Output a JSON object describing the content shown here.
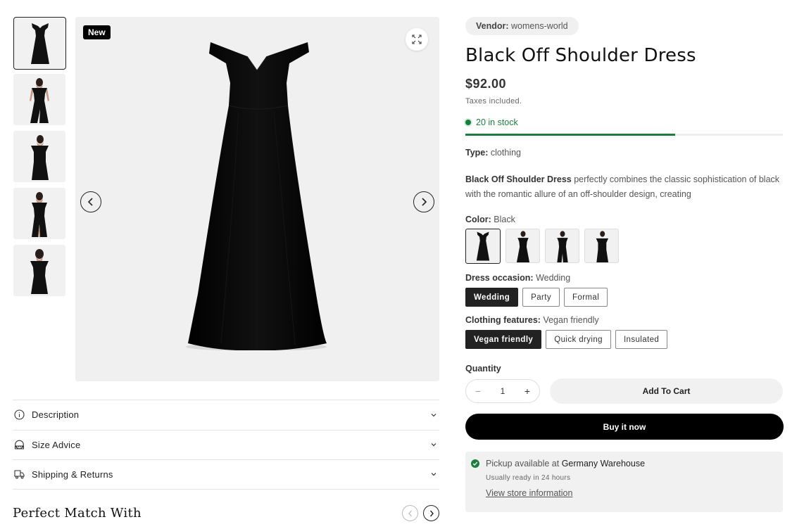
{
  "gallery": {
    "badge": "New",
    "thumbnails": [
      {
        "icon": "dress-front-thumb"
      },
      {
        "icon": "model-dress-thumb"
      },
      {
        "icon": "model-dress-thumb"
      },
      {
        "icon": "model-dress-thumb"
      },
      {
        "icon": "model-dress-thumb"
      }
    ]
  },
  "accordion": [
    {
      "label": "Description",
      "icon": "info-icon"
    },
    {
      "label": "Size Advice",
      "icon": "ruler-icon"
    },
    {
      "label": "Shipping & Returns",
      "icon": "truck-icon"
    }
  ],
  "perfect_match": {
    "title": "Perfect Match With"
  },
  "product": {
    "vendor_label": "Vendor:",
    "vendor_value": "womens-world",
    "title": "Black Off Shoulder Dress",
    "price": "$92.00",
    "taxes": "Taxes included.",
    "stock_text": "20 in stock",
    "stock_fraction": 0.66,
    "type_label": "Type:",
    "type_value": "clothing",
    "desc_bold": "Black Off Shoulder Dress",
    "desc_rest": " perfectly combines the classic sophistication of black with the romantic allure of an off-shoulder design, creating",
    "color_label": "Color:",
    "color_value": "Black",
    "occasion_label": "Dress occasion:",
    "occasion_value": "Wedding",
    "occasion_options": [
      "Wedding",
      "Party",
      "Formal"
    ],
    "features_label": "Clothing features:",
    "features_value": "Vegan friendly",
    "features_options": [
      "Vegan friendly",
      "Quick drying",
      "Insulated"
    ],
    "quantity_label": "Quantity",
    "quantity_value": "1",
    "minus": "−",
    "plus": "+",
    "add_to_cart": "Add To Cart",
    "buy_now": "Buy it now",
    "pickup_prefix": "Pickup available at ",
    "pickup_location": "Germany Warehouse",
    "pickup_sub": "Usually ready in 24 hours",
    "pickup_link": "View store information"
  },
  "colors": {
    "accent_green": "#1a7f3c",
    "black": "#000000"
  }
}
